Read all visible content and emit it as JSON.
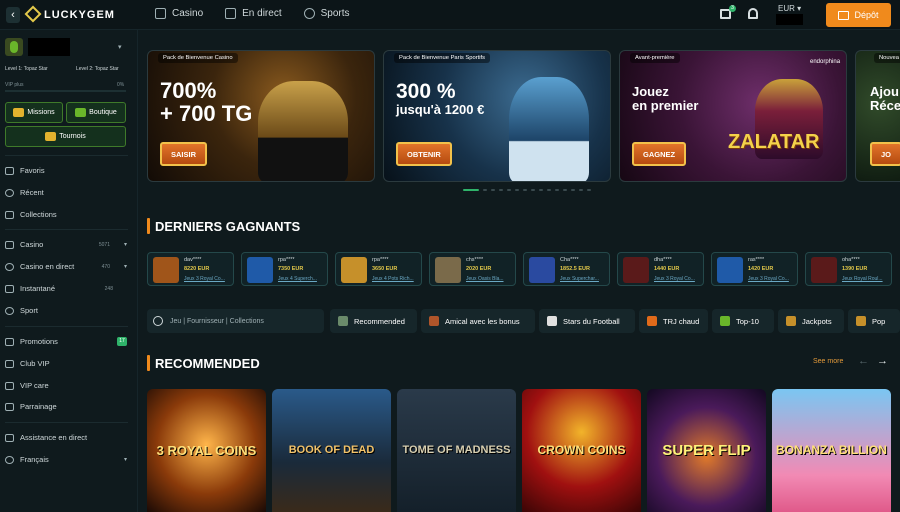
{
  "header": {
    "logo": "LUCKYGEM",
    "nav": [
      {
        "label": "Casino",
        "icon": "spade-icon"
      },
      {
        "label": "En direct",
        "icon": "live-icon"
      },
      {
        "label": "Sports",
        "icon": "ball-icon"
      }
    ],
    "gift_badge": "3",
    "currency": "EUR",
    "deposit_label": "Dépôt"
  },
  "sidebar": {
    "level_left": "Level 1: Topaz Star",
    "level_right": "Level 2: Topaz Star",
    "vip_plus": "VIP plus",
    "progress_pct": "0%",
    "quick": {
      "missions": "Missions",
      "boutique": "Boutique",
      "tournois": "Tournois"
    },
    "items1": [
      {
        "label": "Favoris",
        "icon": "heart-icon"
      },
      {
        "label": "Récent",
        "icon": "clock-icon"
      },
      {
        "label": "Collections",
        "icon": "collection-icon"
      }
    ],
    "items2": [
      {
        "label": "Casino",
        "icon": "cards-icon",
        "count": "5071"
      },
      {
        "label": "Casino en direct",
        "icon": "live-icon",
        "count": "470"
      },
      {
        "label": "Instantané",
        "icon": "bolt-icon",
        "count": "248"
      },
      {
        "label": "Sport",
        "icon": "ball-icon",
        "count": ""
      }
    ],
    "items3": [
      {
        "label": "Promotions",
        "icon": "gift-icon",
        "badge": "17"
      },
      {
        "label": "Club VIP",
        "icon": "crown-icon"
      },
      {
        "label": "VIP care",
        "icon": "heart-hand-icon"
      },
      {
        "label": "Parrainage",
        "icon": "users-icon"
      }
    ],
    "items4": [
      {
        "label": "Assistance en direct",
        "icon": "chat-icon"
      },
      {
        "label": "Français",
        "icon": "globe-icon"
      }
    ]
  },
  "banners": [
    {
      "tag": "Pack de Bienvenue Casino",
      "headline1": "700%",
      "headline2": "+ 700 TG",
      "cta": "SAISIR"
    },
    {
      "tag": "Pack de Bienvenue Paris Sportifs",
      "headline1": "300 %",
      "headline2": "jusqu'à 1200 €",
      "cta": "OBTENIR"
    },
    {
      "tag": "Avant-première",
      "headline1": "Jouez",
      "headline2": "en premier",
      "cta": "GAGNEZ",
      "game": "ZALATAR",
      "brand": "endorphina"
    },
    {
      "tag": "Nouvea",
      "headline1": "Ajou",
      "headline2": "Réce",
      "cta": "JO"
    }
  ],
  "winners_title": "DERNIERS GAGNANTS",
  "winners": [
    {
      "user": "dav****",
      "amount": "8220 EUR",
      "game": "Jeux 3 Royal Co...",
      "color": "#a0551a"
    },
    {
      "user": "rpa****",
      "amount": "7350 EUR",
      "game": "Jeux 4 Superch...",
      "color": "#1f5aa8"
    },
    {
      "user": "rpa****",
      "amount": "3650 EUR",
      "game": "Jeux 4 Pots Rich...",
      "color": "#c6902a"
    },
    {
      "user": "chs****",
      "amount": "2020 EUR",
      "game": "Jeux Oasis Bla...",
      "color": "#7a6a4a"
    },
    {
      "user": "Cha****",
      "amount": "1852.5 EUR",
      "game": "Jeux Superchar...",
      "color": "#2a4aa0"
    },
    {
      "user": "dha****",
      "amount": "1440 EUR",
      "game": "Jeux 3 Royal Co...",
      "color": "#5a1a1a"
    },
    {
      "user": "ras****",
      "amount": "1420 EUR",
      "game": "Jeux 3 Royal Co...",
      "color": "#1f5aa8"
    },
    {
      "user": "oha****",
      "amount": "1390 EUR",
      "game": "Jeux Royal Roul...",
      "color": "#5a1a1a"
    }
  ],
  "search_placeholder": "Jeu | Fournisseur | Collections",
  "chips": [
    {
      "label": "Recommended",
      "color": "#6a8a6a"
    },
    {
      "label": "Amical avec les bonus",
      "color": "#b0552a"
    },
    {
      "label": "Stars du Football",
      "color": "#e0e0e0"
    },
    {
      "label": "TRJ chaud",
      "color": "#e06a1a"
    },
    {
      "label": "Top-10",
      "color": "#6ab62a"
    },
    {
      "label": "Jackpots",
      "color": "#c6902a"
    },
    {
      "label": "Pop",
      "color": "#c6902a"
    }
  ],
  "recommended_title": "RECOMMENDED",
  "see_more": "See more",
  "games": [
    {
      "title": "3 ROYAL COINS",
      "bg": "radial-gradient(circle at 50% 45%,#ffb54a,#8a3a0a 55%,#1a0a05)",
      "color": "#ffe07a"
    },
    {
      "title": "BOOK OF DEAD",
      "bg": "linear-gradient(#2a5a8a,#1a2a3a 60%,#3a2a1a)",
      "color": "#f2c36a"
    },
    {
      "title": "TOME OF MADNESS",
      "bg": "linear-gradient(#2a3a4a,#14202a)",
      "color": "#d8cfb0"
    },
    {
      "title": "CROWN COINS",
      "bg": "radial-gradient(circle at 50% 35%,#f2b42a,#a01010 55%,#3a0505)",
      "color": "#ffe07a"
    },
    {
      "title": "SUPER FLIP",
      "bg": "radial-gradient(circle at 50% 55%,#e07a2a,#4a1a5a 55%,#120820)",
      "color": "#fff27a"
    },
    {
      "title": "BONANZA BILLION",
      "bg": "linear-gradient(#7ac6f2,#f28ab4 70%,#e05a8a)",
      "color": "#ffe07a"
    }
  ]
}
